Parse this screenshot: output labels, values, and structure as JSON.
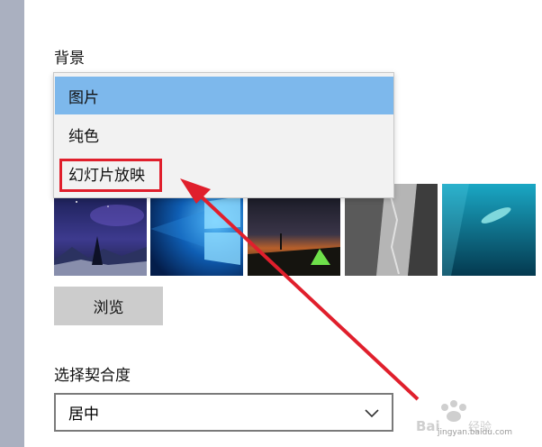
{
  "background_section": {
    "label": "背景",
    "dropdown": {
      "options": [
        "图片",
        "纯色",
        "幻灯片放映"
      ],
      "selected": "图片"
    },
    "thumbnails": [
      "night-sky-tree",
      "windows-blue",
      "night-tent",
      "rock-cliff",
      "underwater-swimmer"
    ],
    "browse_label": "浏览"
  },
  "fit_section": {
    "label": "选择契合度",
    "value": "居中"
  },
  "annotation": {
    "highlight_color": "#e01f2c",
    "arrow_color": "#e01f2c"
  },
  "watermark": {
    "logo_text": "Baidu经验",
    "url": "jingyan.baidu.com"
  },
  "colors": {
    "selected_item": "#7db8ec",
    "browse_button": "#cccccc",
    "dropdown_bg": "#f2f2f2"
  }
}
